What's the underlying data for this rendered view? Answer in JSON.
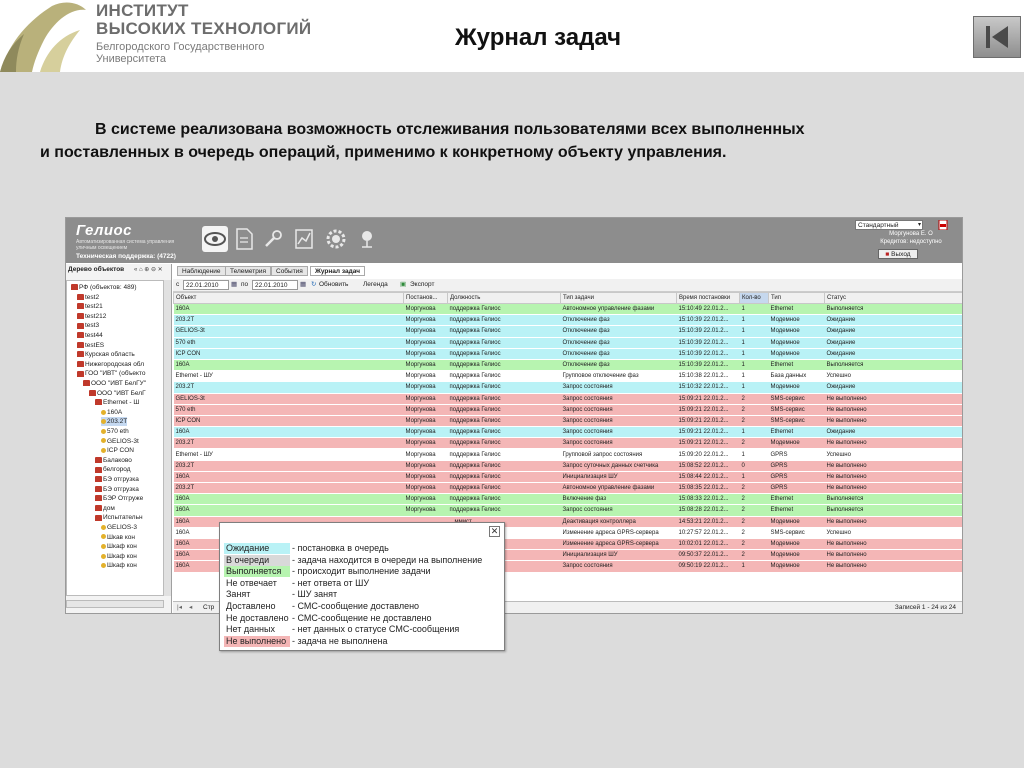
{
  "header": {
    "org_line1": "ИНСТИТУТ",
    "org_line2": "ВЫСОКИХ ТЕХНОЛОГИЙ",
    "org_line3": "Белгородского Государственного",
    "org_line4": "Университета",
    "title": "Журнал задач",
    "back_icon": "skip-back-icon"
  },
  "intro": {
    "line1": "В системе реализована возможность  отслеживания пользователями  всех выполненных",
    "line2": "и поставленных в очередь операций, применимо к конкретному объекту управления."
  },
  "app": {
    "brand": "Гелиос",
    "brand_sub": "Автоматизированная система управления уличным освещением",
    "support": "Техническая поддержка: (4722)",
    "toolbar_icons": [
      "eye-icon",
      "document-icon",
      "settings-tools-icon",
      "chart-icon",
      "gear-icon",
      "network-icon"
    ],
    "preset": "Стандартный",
    "user_name": "Моргунова Е. О",
    "user_credit": "Кредитов: недоступно",
    "exit": "Выход",
    "tree_title": "Дерево объектов",
    "tree": [
      {
        "label": "РФ (объектов: 489)",
        "kind": "node"
      },
      {
        "label": "test2",
        "kind": "node"
      },
      {
        "label": "test21",
        "kind": "node"
      },
      {
        "label": "test212",
        "kind": "node"
      },
      {
        "label": "test3",
        "kind": "node"
      },
      {
        "label": "test44",
        "kind": "node"
      },
      {
        "label": "testES",
        "kind": "node"
      },
      {
        "label": "Курская область",
        "kind": "node"
      },
      {
        "label": "Нижегородская обл",
        "kind": "node"
      },
      {
        "label": "ГОО \"ИВТ\" (объекто",
        "kind": "node"
      },
      {
        "label": "ООО \"ИВТ БелГУ\"",
        "kind": "node"
      },
      {
        "label": "ООО \"ИВТ БелГ",
        "kind": "node"
      },
      {
        "label": "Ethernet - Ш",
        "kind": "node"
      },
      {
        "label": "160A",
        "kind": "leaf"
      },
      {
        "label": "203.2T",
        "kind": "leaf"
      },
      {
        "label": "570 eth",
        "kind": "leaf"
      },
      {
        "label": "GELIOS-3t",
        "kind": "leaf"
      },
      {
        "label": "ICP CON",
        "kind": "leaf"
      },
      {
        "label": "Балаково",
        "kind": "node"
      },
      {
        "label": "белгород",
        "kind": "node"
      },
      {
        "label": "БЭ отгрузка",
        "kind": "node"
      },
      {
        "label": "БЭ отгрузка",
        "kind": "node"
      },
      {
        "label": "БЭР Отгруже",
        "kind": "node"
      },
      {
        "label": "дом",
        "kind": "node"
      },
      {
        "label": "Испытательн",
        "kind": "node"
      },
      {
        "label": "GELIOS-3",
        "kind": "leaf"
      },
      {
        "label": "Шкав кон",
        "kind": "leaf"
      },
      {
        "label": "Шкаф кон",
        "kind": "leaf"
      },
      {
        "label": "Шкаф кон",
        "kind": "leaf"
      },
      {
        "label": "Шкаф кон",
        "kind": "leaf"
      }
    ],
    "tabs": [
      "Наблюдение",
      "Телеметрия",
      "События",
      "Журнал задач"
    ],
    "filter": {
      "from_prefix": "с",
      "date_from": "22.01.2010",
      "to_prefix": "по",
      "date_to": "22.01.2010",
      "refresh": "Обновить",
      "legend": "Легенда",
      "export": "Экспорт"
    },
    "columns": [
      "Объект",
      "Постанов...",
      "Должность",
      "Тип задачи",
      "Время постановки",
      "Кол-во",
      "Тип",
      "Статус"
    ],
    "rows": [
      {
        "c": "g",
        "v": [
          "160A",
          "Моргунова",
          "поддержка Гелиос",
          "Автономное управление фазами",
          "15:10:49 22.01.2...",
          "1",
          "Ethernet",
          "Выполняется"
        ]
      },
      {
        "c": "c",
        "v": [
          "203.2T",
          "Моргунова",
          "поддержка Гелиос",
          "Отключение фаз",
          "15:10:39 22.01.2...",
          "1",
          "Модемное",
          "Ожидание"
        ]
      },
      {
        "c": "c",
        "v": [
          "GELIOS-3t",
          "Моргунова",
          "поддержка Гелиос",
          "Отключение фаз",
          "15:10:39 22.01.2...",
          "1",
          "Модемное",
          "Ожидание"
        ]
      },
      {
        "c": "c",
        "v": [
          "570 eth",
          "Моргунова",
          "поддержка Гелиос",
          "Отключение фаз",
          "15:10:39 22.01.2...",
          "1",
          "Модемное",
          "Ожидание"
        ]
      },
      {
        "c": "c",
        "v": [
          "ICP CON",
          "Моргунова",
          "поддержка Гелиос",
          "Отключение фаз",
          "15:10:39 22.01.2...",
          "1",
          "Модемное",
          "Ожидание"
        ]
      },
      {
        "c": "g",
        "v": [
          "160A",
          "Моргунова",
          "поддержка Гелиос",
          "Отключение фаз",
          "15:10:39 22.01.2...",
          "1",
          "Ethernet",
          "Выполняется"
        ]
      },
      {
        "c": "w",
        "v": [
          "Ethernet - ШУ",
          "Моргунова",
          "поддержка Гелиос",
          "Групповое отключение фаз",
          "15:10:38 22.01.2...",
          "1",
          "База данных",
          "Успешно"
        ]
      },
      {
        "c": "c",
        "v": [
          "203.2T",
          "Моргунова",
          "поддержка Гелиос",
          "Запрос состояния",
          "15:10:32 22.01.2...",
          "1",
          "Модемное",
          "Ожидание"
        ]
      },
      {
        "c": "r",
        "v": [
          "GELIOS-3t",
          "Моргунова",
          "поддержка Гелиос",
          "Запрос состояния",
          "15:09:21 22.01.2...",
          "2",
          "SMS-сервис",
          "Не выполнено"
        ]
      },
      {
        "c": "r",
        "v": [
          "570 eth",
          "Моргунова",
          "поддержка Гелиос",
          "Запрос состояния",
          "15:09:21 22.01.2...",
          "2",
          "SMS-сервис",
          "Не выполнено"
        ]
      },
      {
        "c": "r",
        "v": [
          "ICP CON",
          "Моргунова",
          "поддержка Гелиос",
          "Запрос состояния",
          "15:09:21 22.01.2...",
          "2",
          "SMS-сервис",
          "Не выполнено"
        ]
      },
      {
        "c": "c",
        "v": [
          "160A",
          "Моргунова",
          "поддержка Гелиос",
          "Запрос состояния",
          "15:09:21 22.01.2...",
          "1",
          "Ethernet",
          "Ожидание"
        ]
      },
      {
        "c": "r",
        "v": [
          "203.2T",
          "Моргунова",
          "поддержка Гелиос",
          "Запрос состояния",
          "15:09:21 22.01.2...",
          "2",
          "Модемное",
          "Не выполнено"
        ]
      },
      {
        "c": "w",
        "v": [
          "Ethernet - ШУ",
          "Моргунова",
          "поддержка Гелиос",
          "Групповой запрос состояния",
          "15:09:20 22.01.2...",
          "1",
          "GPRS",
          "Успешно"
        ]
      },
      {
        "c": "r",
        "v": [
          "203.2T",
          "Моргунова",
          "поддержка Гелиос",
          "Запрос суточных данных счетчика",
          "15:08:52 22.01.2...",
          "0",
          "GPRS",
          "Не выполнено"
        ]
      },
      {
        "c": "r",
        "v": [
          "160A",
          "Моргунова",
          "поддержка Гелиос",
          "Инициализация ШУ",
          "15:08:44 22.01.2...",
          "1",
          "GPRS",
          "Не выполнено"
        ]
      },
      {
        "c": "r",
        "v": [
          "203.2T",
          "Моргунова",
          "поддержка Гелиос",
          "Автономное управление фазами",
          "15:08:35 22.01.2...",
          "2",
          "GPRS",
          "Не выполнено"
        ]
      },
      {
        "c": "g",
        "v": [
          "160A",
          "Моргунова",
          "поддержка Гелиос",
          "Включение фаз",
          "15:08:33 22.01.2...",
          "2",
          "Ethernet",
          "Выполняется"
        ]
      },
      {
        "c": "g",
        "v": [
          "160A",
          "Моргунова",
          "поддержка Гелиос",
          "Запрос состояния",
          "15:08:28 22.01.2...",
          "2",
          "Ethernet",
          "Выполняется"
        ]
      },
      {
        "c": "r",
        "v": [
          "160A",
          "",
          "...ммист",
          "Деактивация контроллера",
          "14:53:21 22.01.2...",
          "2",
          "Модемное",
          "Не выполнено"
        ]
      },
      {
        "c": "w",
        "v": [
          "160A",
          "",
          "",
          "Изменение адреса GPRS-сервера",
          "10:27:57 22.01.2...",
          "2",
          "SMS-сервис",
          "Успешно"
        ]
      },
      {
        "c": "r",
        "v": [
          "160A",
          "",
          "",
          "Изменение адреса GPRS-сервера",
          "10:02:01 22.01.2...",
          "2",
          "Модемное",
          "Не выполнено"
        ]
      },
      {
        "c": "r",
        "v": [
          "160A",
          "",
          "",
          "Инициализация ШУ",
          "09:50:37 22.01.2...",
          "2",
          "Модемное",
          "Не выполнено"
        ]
      },
      {
        "c": "r",
        "v": [
          "160A",
          "",
          "",
          "Запрос состояния",
          "09:50:19 22.01.2...",
          "1",
          "Модемное",
          "Не выполнено"
        ]
      }
    ],
    "pager_text": "Стр",
    "records": "Записей 1 - 24 из 24",
    "legend_popup": [
      {
        "status": "Ожидание",
        "desc": "- постановка в очередь",
        "color": "#b9f2f6"
      },
      {
        "status": "В очереди",
        "desc": "- задача находится в очереди на выполнение",
        "color": "#d9d9d9"
      },
      {
        "status": "Выполняется",
        "desc": "- происходит выполнение задачи",
        "color": "#b7f4b0"
      },
      {
        "status": "Не отвечает",
        "desc": "- нет ответа от ШУ",
        "color": "#ffffff"
      },
      {
        "status": "Занят",
        "desc": "- ШУ занят",
        "color": "#ffffff"
      },
      {
        "status": "Доставлено",
        "desc": "- СМС-сообщение доставлено",
        "color": "#ffffff"
      },
      {
        "status": "Не доставлено",
        "desc": "- СМС-сообщение не доставлено",
        "color": "#ffffff"
      },
      {
        "status": "Нет данных",
        "desc": "- нет данных о статусе СМС-сообщения",
        "color": "#ffffff"
      },
      {
        "status": "Не выполнено",
        "desc": "- задача не выполнена",
        "color": "#f4b6b6"
      }
    ]
  }
}
